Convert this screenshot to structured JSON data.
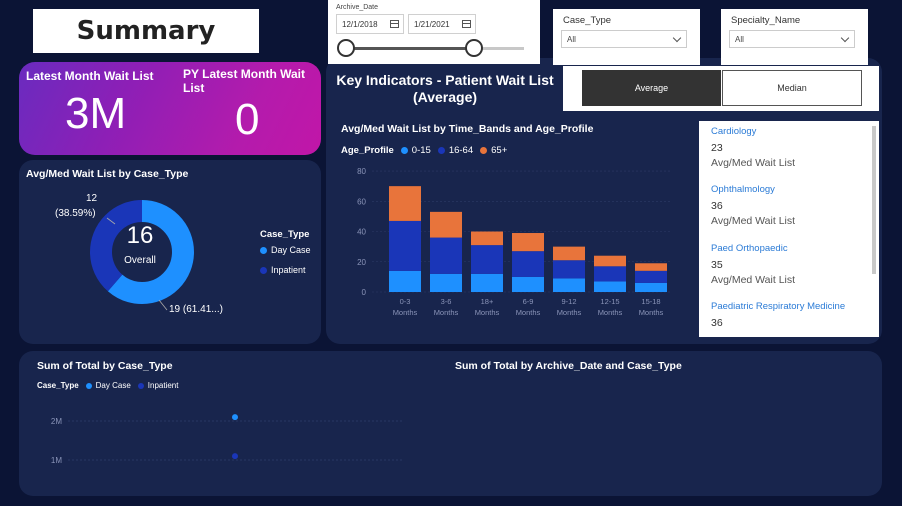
{
  "header": {
    "title": "Summary"
  },
  "archive_date": {
    "label": "Archive_Date",
    "start": "12/1/2018",
    "end": "1/21/2021"
  },
  "filters": {
    "case_type": {
      "label": "Case_Type",
      "value": "All"
    },
    "specialty": {
      "label": "Specialty_Name",
      "value": "All"
    }
  },
  "kpi": {
    "latest_label": "Latest Month Wait List",
    "latest_value": "3M",
    "py_label": "PY Latest Month Wait List",
    "py_value": "0"
  },
  "key_indicators": {
    "title": "Key Indicators - Patient Wait List (Average)"
  },
  "toggle": {
    "average": "Average",
    "median": "Median"
  },
  "donut": {
    "title": "Avg/Med Wait List by Case_Type",
    "center_value": "16",
    "center_label": "Overall",
    "label_inpatient_count": "12",
    "label_inpatient_pct": "(38.59%)",
    "label_daycase": "19 (61.41...)",
    "legend_title": "Case_Type",
    "legend": [
      "Day Case",
      "Inpatient"
    ]
  },
  "bar_chart": {
    "title": "Avg/Med Wait List by Time_Bands and Age_Profile",
    "legend_title": "Age_Profile",
    "legend": [
      "0-15",
      "16-64",
      "65+"
    ]
  },
  "specialties": [
    {
      "name": "Cardiology",
      "value": "23",
      "label": "Avg/Med Wait List"
    },
    {
      "name": "Ophthalmology",
      "value": "36",
      "label": "Avg/Med Wait List"
    },
    {
      "name": "Paed Orthopaedic",
      "value": "35",
      "label": "Avg/Med Wait List"
    },
    {
      "name": "Paediatric Respiratory Medicine",
      "value": "36",
      "label": ""
    }
  ],
  "bottom_left": {
    "title": "Sum of Total by Case_Type",
    "legend_title": "Case_Type",
    "legend": [
      "Day Case",
      "Inpatient"
    ],
    "ticks": [
      "2M",
      "1M"
    ]
  },
  "bottom_right": {
    "title": "Sum of Total by Archive_Date and Case_Type"
  },
  "colors": {
    "day_case": "#1e90ff",
    "inpatient": "#1a36b8",
    "age_0_15": "#1e90ff",
    "age_16_64": "#1a36b8",
    "age_65": "#e8743b",
    "panel": "#18254d",
    "background": "#0b1435"
  },
  "chart_data": [
    {
      "type": "pie",
      "title": "Avg/Med Wait List by Case_Type",
      "categories": [
        "Day Case",
        "Inpatient"
      ],
      "values": [
        19,
        12
      ],
      "percent": [
        61.41,
        38.59
      ]
    },
    {
      "type": "bar",
      "stacked": true,
      "title": "Avg/Med Wait List by Time_Bands and Age_Profile",
      "categories": [
        "0-3 Months",
        "3-6 Months",
        "18+ Months",
        "6-9 Months",
        "9-12 Months",
        "12-15 Months",
        "15-18 Months"
      ],
      "series": [
        {
          "name": "0-15",
          "values": [
            14,
            12,
            12,
            10,
            9,
            7,
            6
          ]
        },
        {
          "name": "16-64",
          "values": [
            33,
            24,
            19,
            17,
            12,
            10,
            8
          ]
        },
        {
          "name": "65+",
          "values": [
            23,
            17,
            9,
            12,
            9,
            7,
            5
          ]
        }
      ],
      "yticks": [
        0,
        20,
        40,
        60,
        80
      ],
      "ylim": [
        0,
        82
      ]
    },
    {
      "type": "scatter",
      "title": "Sum of Total by Case_Type",
      "series": [
        {
          "name": "Day Case",
          "values": [
            2100000
          ]
        },
        {
          "name": "Inpatient",
          "values": [
            1100000
          ]
        }
      ],
      "yticks": [
        "2M",
        "1M"
      ]
    }
  ]
}
